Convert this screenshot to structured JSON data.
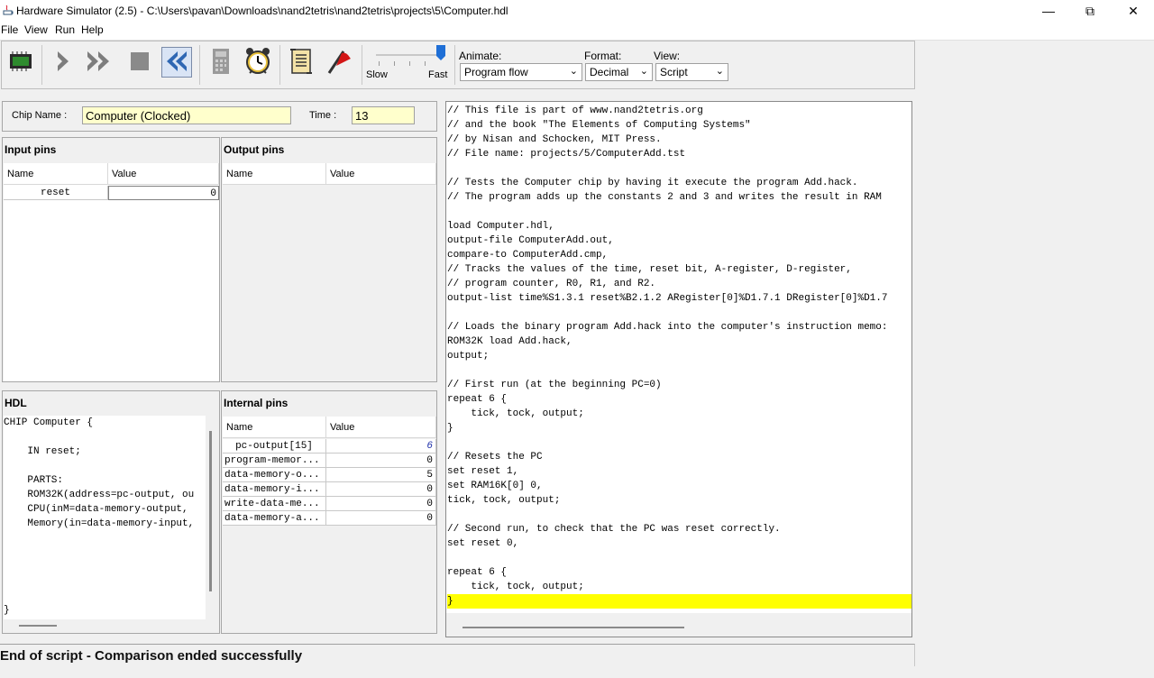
{
  "window": {
    "title": "Hardware Simulator (2.5) - C:\\Users\\pavan\\Downloads\\nand2tetris\\nand2tetris\\projects\\5\\Computer.hdl",
    "controls": {
      "minimize": "—",
      "maximize": "⧉",
      "close": "✕"
    }
  },
  "menu": [
    "File",
    "View",
    "Run",
    "Help"
  ],
  "toolbar": {
    "speed": {
      "slow": "Slow",
      "fast": "Fast",
      "level": 1.0
    },
    "animate": {
      "label": "Animate:",
      "value": "Program flow"
    },
    "format": {
      "label": "Format:",
      "value": "Decimal"
    },
    "view": {
      "label": "View:",
      "value": "Script"
    },
    "icons": [
      "chip-icon",
      "single-step-icon",
      "fast-forward-icon",
      "stop-icon",
      "rewind-icon",
      "calculator-icon",
      "clock-icon",
      "script-icon",
      "breakpoint-flag-icon"
    ]
  },
  "chip": {
    "name_label": "Chip Name :",
    "name_value": "Computer (Clocked)",
    "time_label": "Time :",
    "time_value": "13"
  },
  "input_pins": {
    "title": "Input pins",
    "headers": [
      "Name",
      "Value"
    ],
    "rows": [
      {
        "name": "reset",
        "value": "0"
      }
    ]
  },
  "output_pins": {
    "title": "Output pins",
    "headers": [
      "Name",
      "Value"
    ],
    "rows": []
  },
  "hdl": {
    "title": "HDL",
    "lines": [
      "CHIP Computer {",
      "",
      "    IN reset;",
      "",
      "    PARTS:",
      "    ROM32K(address=pc-output, ou",
      "    CPU(inM=data-memory-output,",
      "    Memory(in=data-memory-input,",
      "",
      "",
      "",
      "",
      "",
      "}"
    ]
  },
  "internal_pins": {
    "title": "Internal pins",
    "headers": [
      "Name",
      "Value"
    ],
    "rows": [
      {
        "name": "pc-output[15]",
        "value": "6"
      },
      {
        "name": "program-memor...",
        "value": "0"
      },
      {
        "name": "data-memory-o...",
        "value": "5"
      },
      {
        "name": "data-memory-i...",
        "value": "0"
      },
      {
        "name": "write-data-me...",
        "value": "0"
      },
      {
        "name": "data-memory-a...",
        "value": "0"
      }
    ]
  },
  "script": {
    "lines": [
      "// This file is part of www.nand2tetris.org",
      "// and the book \"The Elements of Computing Systems\"",
      "// by Nisan and Schocken, MIT Press.",
      "// File name: projects/5/ComputerAdd.tst",
      "",
      "// Tests the Computer chip by having it execute the program Add.hack.",
      "// The program adds up the constants 2 and 3 and writes the result in RAM",
      "",
      "load Computer.hdl,",
      "output-file ComputerAdd.out,",
      "compare-to ComputerAdd.cmp,",
      "// Tracks the values of the time, reset bit, A-register, D-register,",
      "// program counter, R0, R1, and R2.",
      "output-list time%S1.3.1 reset%B2.1.2 ARegister[0]%D1.7.1 DRegister[0]%D1.7",
      "",
      "// Loads the binary program Add.hack into the computer's instruction memo:",
      "ROM32K load Add.hack,",
      "output;",
      "",
      "// First run (at the beginning PC=0)",
      "repeat 6 {",
      "    tick, tock, output;",
      "}",
      "",
      "// Resets the PC",
      "set reset 1,",
      "set RAM16K[0] 0,",
      "tick, tock, output;",
      "",
      "// Second run, to check that the PC was reset correctly.",
      "set reset 0,",
      "",
      "repeat 6 {",
      "    tick, tock, output;",
      "}"
    ],
    "highlight_line": 34
  },
  "status": "End of script - Comparison ended successfully"
}
